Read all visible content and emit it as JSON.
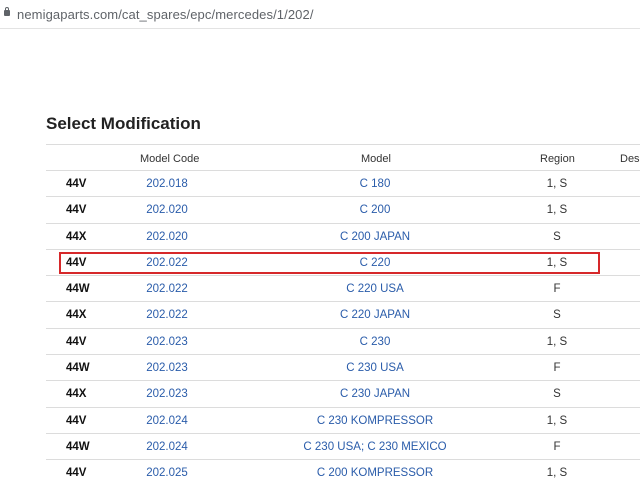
{
  "address_bar": {
    "url": "nemigaparts.com/cat_spares/epc/mercedes/1/202/"
  },
  "page": {
    "title": "Select Modification"
  },
  "table": {
    "headers": {
      "model_code": "Model Code",
      "model": "Model",
      "region": "Region",
      "description": "Desc"
    },
    "rows": [
      {
        "code": "44V",
        "model_code": "202.018",
        "model": "C 180",
        "region": "1, S"
      },
      {
        "code": "44V",
        "model_code": "202.020",
        "model": "C 200",
        "region": "1, S"
      },
      {
        "code": "44X",
        "model_code": "202.020",
        "model": "C 200 JAPAN",
        "region": "S"
      },
      {
        "code": "44V",
        "model_code": "202.022",
        "model": "C 220",
        "region": "1, S",
        "highlighted": true
      },
      {
        "code": "44W",
        "model_code": "202.022",
        "model": "C 220 USA",
        "region": "F"
      },
      {
        "code": "44X",
        "model_code": "202.022",
        "model": "C 220 JAPAN",
        "region": "S"
      },
      {
        "code": "44V",
        "model_code": "202.023",
        "model": "C 230",
        "region": "1, S"
      },
      {
        "code": "44W",
        "model_code": "202.023",
        "model": "C 230 USA",
        "region": "F"
      },
      {
        "code": "44X",
        "model_code": "202.023",
        "model": "C 230 JAPAN",
        "region": "S"
      },
      {
        "code": "44V",
        "model_code": "202.024",
        "model": "C 230 KOMPRESSOR",
        "region": "1, S"
      },
      {
        "code": "44W",
        "model_code": "202.024",
        "model": "C 230 USA; C 230 MEXICO",
        "region": "F"
      },
      {
        "code": "44V",
        "model_code": "202.025",
        "model": "C 200 KOMPRESSOR",
        "region": "1, S"
      }
    ]
  },
  "colors": {
    "link": "#2a5caa",
    "highlight_border": "#d6282a"
  }
}
